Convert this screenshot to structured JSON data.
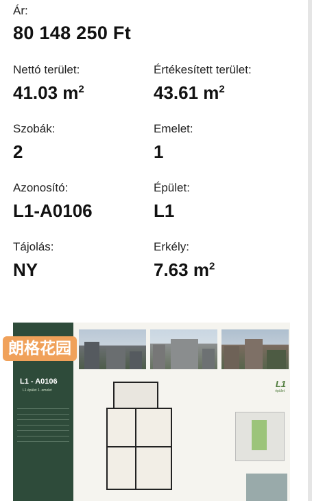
{
  "price": {
    "label": "Ár:",
    "value": "80 148 250 Ft"
  },
  "details": [
    {
      "left": {
        "label": "Nettó terület:",
        "value": "41.03 m",
        "unit_sup": "2"
      },
      "right": {
        "label": "Értékesített terület:",
        "value": "43.61 m",
        "unit_sup": "2"
      }
    },
    {
      "left": {
        "label": "Szobák:",
        "value": "2",
        "unit_sup": ""
      },
      "right": {
        "label": "Emelet:",
        "value": "1",
        "unit_sup": ""
      }
    },
    {
      "left": {
        "label": "Azonosító:",
        "value": "L1-A0106",
        "unit_sup": ""
      },
      "right": {
        "label": "Épület:",
        "value": "L1",
        "unit_sup": ""
      }
    },
    {
      "left": {
        "label": "Tájolás:",
        "value": "NY",
        "unit_sup": ""
      },
      "right": {
        "label": "Erkély:",
        "value": "7.63 m",
        "unit_sup": "2"
      }
    }
  ],
  "brochure": {
    "apartment_id": "L1 - A0106",
    "building_floor": "L1 épület\n1. emelet",
    "site_tag": "L1",
    "site_sub": "épület",
    "watermark_text": "朗格花园",
    "panel_color": "#2e4b3a",
    "watermark_color": "#f0a15a"
  }
}
